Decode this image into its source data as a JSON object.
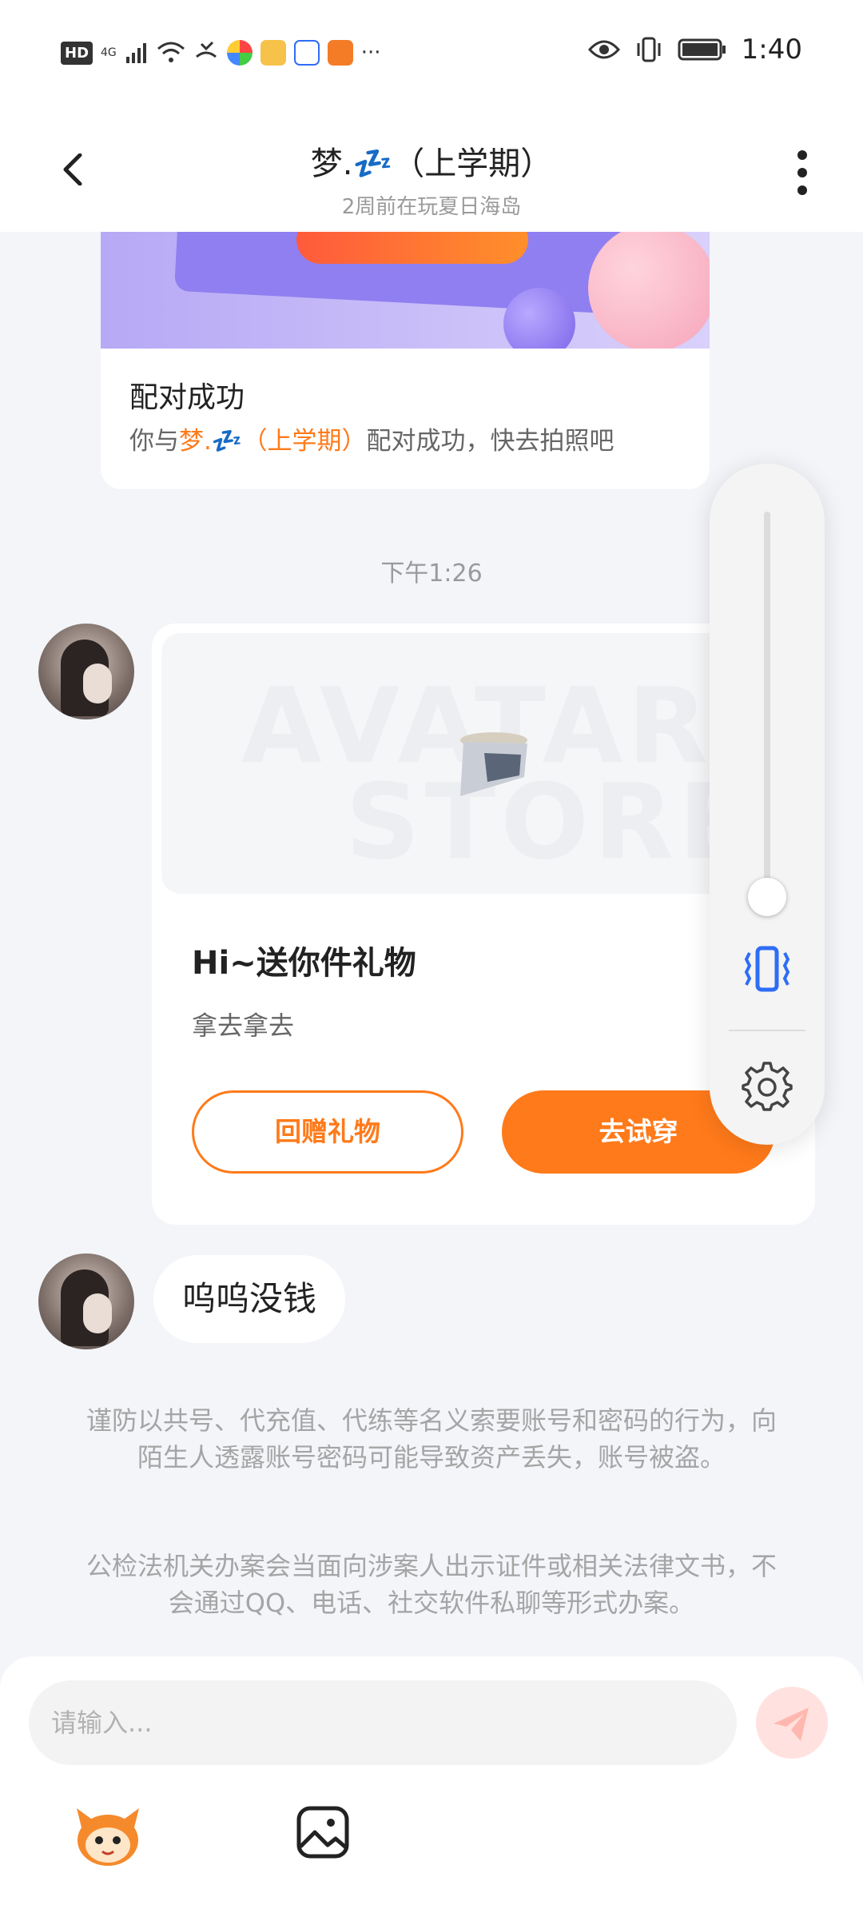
{
  "status_bar": {
    "hd": "HD",
    "signal": "4G",
    "time": "1:40",
    "more": "···"
  },
  "header": {
    "title": "梦.💤（上学期）",
    "subtitle": "2周前在玩夏日海岛"
  },
  "match_card": {
    "title": "配对成功",
    "desc_prefix": "你与",
    "desc_name": "梦.💤（上学期）",
    "desc_suffix": "配对成功，快去拍照吧"
  },
  "timestamp": "下午1:26",
  "gift_card": {
    "watermark_line1": "AVATAR",
    "watermark_line2": "STORE",
    "title": "Hi~送你件礼物",
    "subtitle": "拿去拿去",
    "return_gift_button": "回赠礼物",
    "try_on_button": "去试穿"
  },
  "message": {
    "text": "呜呜没钱"
  },
  "notices": [
    "谨防以共号、代充值、代练等名义索要账号和密码的行为，向陌生人透露账号密码可能导致资产丢失，账号被盗。",
    "公检法机关办案会当面向涉案人出示证件或相关法律文书，不会通过QQ、电话、社交软件私聊等形式办案。"
  ],
  "volume_panel": {
    "level": 0.05
  },
  "input_bar": {
    "placeholder": "请输入..."
  },
  "colors": {
    "accent": "#ff7a1a",
    "background": "#f3f5f9"
  }
}
